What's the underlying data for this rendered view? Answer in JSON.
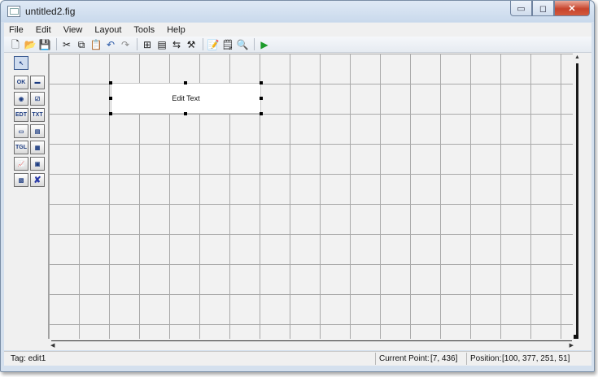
{
  "window": {
    "title": "untitled2.fig",
    "buttons": {
      "minimize": "▭",
      "maximize": "◻",
      "close": "✕"
    }
  },
  "menu": [
    "File",
    "Edit",
    "View",
    "Layout",
    "Tools",
    "Help"
  ],
  "toolbar": {
    "icons": [
      {
        "name": "new-icon",
        "glyph": "🗋"
      },
      {
        "name": "open-icon",
        "glyph": "📂"
      },
      {
        "name": "save-icon",
        "glyph": "💾"
      },
      {
        "name": "cut-icon",
        "glyph": "✂"
      },
      {
        "name": "copy-icon",
        "glyph": "⧉"
      },
      {
        "name": "paste-icon",
        "glyph": "📋"
      },
      {
        "name": "undo-icon",
        "glyph": "↶"
      },
      {
        "name": "redo-icon",
        "glyph": "↷"
      },
      {
        "name": "align-icon",
        "glyph": "⊞"
      },
      {
        "name": "menu-editor-icon",
        "glyph": "▤"
      },
      {
        "name": "tab-order-icon",
        "glyph": "⇆"
      },
      {
        "name": "toolbar-editor-icon",
        "glyph": "⚒"
      },
      {
        "name": "mfile-editor-icon",
        "glyph": "📝"
      },
      {
        "name": "property-inspector-icon",
        "glyph": "🗒"
      },
      {
        "name": "object-browser-icon",
        "glyph": "🔍"
      },
      {
        "name": "run-icon",
        "glyph": "▶"
      }
    ]
  },
  "palette": [
    {
      "name": "select-tool-icon",
      "label": "↖",
      "selected": true
    },
    {
      "name": "push-button-tool-icon",
      "label": "OK"
    },
    {
      "name": "slider-tool-icon",
      "label": "▬"
    },
    {
      "name": "radio-button-tool-icon",
      "label": "◉"
    },
    {
      "name": "checkbox-tool-icon",
      "label": "☑"
    },
    {
      "name": "edit-text-tool-icon",
      "label": "EDT"
    },
    {
      "name": "static-text-tool-icon",
      "label": "TXT"
    },
    {
      "name": "popup-menu-tool-icon",
      "label": "▭"
    },
    {
      "name": "listbox-tool-icon",
      "label": "▤"
    },
    {
      "name": "toggle-button-tool-icon",
      "label": "TGL"
    },
    {
      "name": "table-tool-icon",
      "label": "▦"
    },
    {
      "name": "axes-tool-icon",
      "label": "📈"
    },
    {
      "name": "panel-tool-icon",
      "label": "▣"
    },
    {
      "name": "button-group-tool-icon",
      "label": "▧"
    },
    {
      "name": "activex-tool-icon",
      "label": "✘"
    }
  ],
  "canvas": {
    "edit_text_label": "Edit Text"
  },
  "status": {
    "tag": "Tag: edit1",
    "current_point_label": "Current Point:",
    "current_point": "[7, 436]",
    "position_label": "Position:",
    "position": "[100, 377, 251, 51]"
  },
  "colors": {
    "titlebar": "#c9d9ec",
    "close_button": "#c7442c",
    "grid_line": "#a9a9a9",
    "canvas_bg": "#f2f2f2",
    "run_icon": "#1c9b2a"
  }
}
